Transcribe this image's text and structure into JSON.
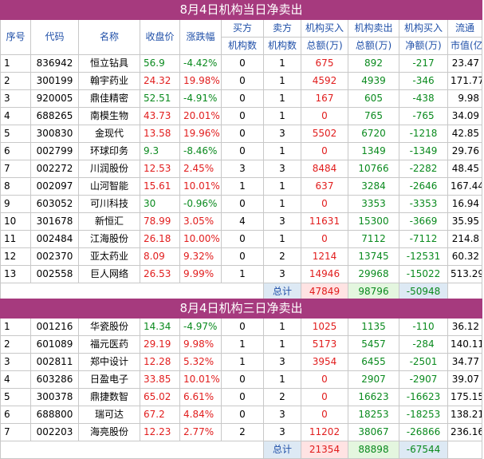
{
  "section1": {
    "title": "8月4日机构当日净卖出",
    "headers": [
      "序号",
      "代码",
      "名称",
      "收盘价",
      "涨跌幅",
      "买方",
      "卖方",
      "机构买入",
      "机构卖出",
      "机构买入",
      "流通"
    ],
    "subheaders": [
      "机构数",
      "机构数",
      "总额(万)",
      "总额(万)",
      "净额(万)",
      "市值(亿)"
    ],
    "rows": [
      {
        "no": "1",
        "code": "836942",
        "name": "恒立钻具",
        "close": "56.9",
        "chg": "-4.42%",
        "buy": "0",
        "sell": "1",
        "binv": "675",
        "sinv": "892",
        "net": "-217",
        "cap": "23.47",
        "color": "green"
      },
      {
        "no": "2",
        "code": "300199",
        "name": "翰宇药业",
        "close": "24.32",
        "chg": "19.98%",
        "buy": "0",
        "sell": "1",
        "binv": "4592",
        "sinv": "4939",
        "net": "-346",
        "cap": "171.77",
        "color": "red"
      },
      {
        "no": "3",
        "code": "920005",
        "name": "鼎佳精密",
        "close": "52.51",
        "chg": "-4.91%",
        "buy": "0",
        "sell": "1",
        "binv": "167",
        "sinv": "605",
        "net": "-438",
        "cap": "9.98",
        "color": "green"
      },
      {
        "no": "4",
        "code": "688265",
        "name": "南模生物",
        "close": "43.73",
        "chg": "20.01%",
        "buy": "0",
        "sell": "1",
        "binv": "0",
        "sinv": "765",
        "net": "-765",
        "cap": "34.09",
        "color": "red"
      },
      {
        "no": "5",
        "code": "300830",
        "name": "金现代",
        "close": "13.58",
        "chg": "19.96%",
        "buy": "0",
        "sell": "3",
        "binv": "5502",
        "sinv": "6720",
        "net": "-1218",
        "cap": "42.85",
        "color": "red"
      },
      {
        "no": "6",
        "code": "002799",
        "name": "环球印务",
        "close": "9.3",
        "chg": "-8.46%",
        "buy": "0",
        "sell": "1",
        "binv": "0",
        "sinv": "1349",
        "net": "-1349",
        "cap": "29.76",
        "color": "green"
      },
      {
        "no": "7",
        "code": "002272",
        "name": "川润股份",
        "close": "12.53",
        "chg": "2.45%",
        "buy": "3",
        "sell": "3",
        "binv": "8484",
        "sinv": "10766",
        "net": "-2282",
        "cap": "48.45",
        "color": "red"
      },
      {
        "no": "8",
        "code": "002097",
        "name": "山河智能",
        "close": "15.61",
        "chg": "10.01%",
        "buy": "1",
        "sell": "1",
        "binv": "637",
        "sinv": "3284",
        "net": "-2646",
        "cap": "167.44",
        "color": "red"
      },
      {
        "no": "9",
        "code": "603052",
        "name": "可川科技",
        "close": "30",
        "chg": "-0.96%",
        "buy": "0",
        "sell": "1",
        "binv": "0",
        "sinv": "3353",
        "net": "-3353",
        "cap": "16.94",
        "color": "green"
      },
      {
        "no": "10",
        "code": "301678",
        "name": "新恒汇",
        "close": "78.99",
        "chg": "3.05%",
        "buy": "4",
        "sell": "3",
        "binv": "11631",
        "sinv": "15300",
        "net": "-3669",
        "cap": "35.95",
        "color": "red"
      },
      {
        "no": "11",
        "code": "002484",
        "name": "江海股份",
        "close": "26.18",
        "chg": "10.00%",
        "buy": "0",
        "sell": "1",
        "binv": "0",
        "sinv": "7112",
        "net": "-7112",
        "cap": "214.8",
        "color": "red"
      },
      {
        "no": "12",
        "code": "002370",
        "name": "亚太药业",
        "close": "8.09",
        "chg": "9.32%",
        "buy": "0",
        "sell": "2",
        "binv": "1214",
        "sinv": "13745",
        "net": "-12531",
        "cap": "60.32",
        "color": "red"
      },
      {
        "no": "13",
        "code": "002558",
        "name": "巨人网络",
        "close": "26.53",
        "chg": "9.99%",
        "buy": "1",
        "sell": "3",
        "binv": "14946",
        "sinv": "29968",
        "net": "-15022",
        "cap": "513.29",
        "color": "red"
      }
    ],
    "total": {
      "label": "总计",
      "binv": "47849",
      "sinv": "98796",
      "net": "-50948"
    }
  },
  "section2": {
    "title": "8月4日机构三日净卖出",
    "rows": [
      {
        "no": "1",
        "code": "001216",
        "name": "华瓷股份",
        "close": "14.34",
        "chg": "-4.97%",
        "buy": "0",
        "sell": "1",
        "binv": "1025",
        "sinv": "1135",
        "net": "-110",
        "cap": "36.12",
        "color": "green"
      },
      {
        "no": "2",
        "code": "601089",
        "name": "福元医药",
        "close": "29.19",
        "chg": "9.98%",
        "buy": "1",
        "sell": "1",
        "binv": "5173",
        "sinv": "5457",
        "net": "-284",
        "cap": "140.11",
        "color": "red"
      },
      {
        "no": "3",
        "code": "002811",
        "name": "郑中设计",
        "close": "12.28",
        "chg": "5.32%",
        "buy": "1",
        "sell": "3",
        "binv": "3954",
        "sinv": "6455",
        "net": "-2501",
        "cap": "34.77",
        "color": "red"
      },
      {
        "no": "4",
        "code": "603286",
        "name": "日盈电子",
        "close": "33.85",
        "chg": "10.01%",
        "buy": "0",
        "sell": "1",
        "binv": "0",
        "sinv": "2907",
        "net": "-2907",
        "cap": "39.07",
        "color": "red"
      },
      {
        "no": "5",
        "code": "300378",
        "name": "鼎捷数智",
        "close": "65.02",
        "chg": "6.61%",
        "buy": "0",
        "sell": "2",
        "binv": "0",
        "sinv": "16623",
        "net": "-16623",
        "cap": "175.15",
        "color": "red"
      },
      {
        "no": "6",
        "code": "688800",
        "name": "瑞可达",
        "close": "67.2",
        "chg": "4.84%",
        "buy": "0",
        "sell": "3",
        "binv": "0",
        "sinv": "18253",
        "net": "-18253",
        "cap": "138.21",
        "color": "red"
      },
      {
        "no": "7",
        "code": "002203",
        "name": "海亮股份",
        "close": "12.23",
        "chg": "2.77%",
        "buy": "2",
        "sell": "3",
        "binv": "11202",
        "sinv": "38067",
        "net": "-26866",
        "cap": "236.16",
        "color": "red"
      }
    ],
    "total": {
      "label": "总计",
      "binv": "21354",
      "sinv": "88898",
      "net": "-67544"
    }
  }
}
